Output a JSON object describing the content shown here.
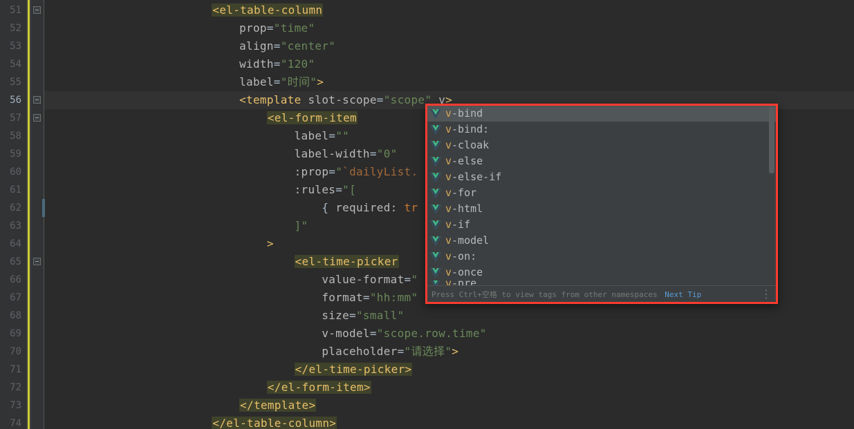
{
  "lines": {
    "start": 51,
    "end": 74,
    "active": 56,
    "fold_rows": [
      51,
      56,
      57,
      65
    ],
    "mod_rows": [
      62
    ]
  },
  "code": {
    "l51": {
      "indent": "",
      "open": "<",
      "tag": "el-table-column"
    },
    "l52": {
      "indent": "    ",
      "attr": "prop",
      "val": "time"
    },
    "l53": {
      "indent": "    ",
      "attr": "align",
      "val": "center"
    },
    "l54": {
      "indent": "    ",
      "attr": "width",
      "val": "120"
    },
    "l55": {
      "indent": "    ",
      "attr": "label",
      "val": "时间",
      "close": ">"
    },
    "l56": {
      "indent": "    ",
      "open": "<",
      "tag": "template",
      "a1": "slot-scope",
      "v1": "scope",
      "a2": "v",
      "close": ">"
    },
    "l57": {
      "indent": "        ",
      "open": "<",
      "tag": "el-form-item"
    },
    "l58": {
      "indent": "            ",
      "attr": "label",
      "val": ""
    },
    "l59": {
      "indent": "            ",
      "attr": "label-width",
      "val": "0"
    },
    "l60": {
      "indent": "            ",
      "attr": ":prop",
      "val": "`dailyList."
    },
    "l61": {
      "indent": "            ",
      "attr": ":rules",
      "val": "["
    },
    "l62": {
      "indent": "                ",
      "text": "{ required: tr"
    },
    "l63": {
      "indent": "            ",
      "text": "]\""
    },
    "l64": {
      "indent": "        ",
      "text": ">"
    },
    "l65": {
      "indent": "            ",
      "open": "<",
      "tag": "el-time-picker"
    },
    "l66": {
      "indent": "                ",
      "attr": "value-format",
      "val": ""
    },
    "l67": {
      "indent": "                ",
      "attr": "format",
      "val": "hh:mm"
    },
    "l68": {
      "indent": "                ",
      "attr": "size",
      "val": "small"
    },
    "l69": {
      "indent": "                ",
      "attr": "v-model",
      "val": "scope.row.time"
    },
    "l70": {
      "indent": "                ",
      "attr": "placeholder",
      "val": "请选择",
      "close": ">"
    },
    "l71": {
      "indent": "            ",
      "closeTag": "el-time-picker"
    },
    "l72": {
      "indent": "        ",
      "closeTag": "el-form-item"
    },
    "l73": {
      "indent": "    ",
      "closeTag": "template"
    },
    "l74": {
      "indent": "",
      "closeTag": "el-table-column"
    }
  },
  "popup": {
    "selected": 0,
    "items": [
      {
        "label": "v-bind"
      },
      {
        "label": "v-bind:"
      },
      {
        "label": "v-cloak"
      },
      {
        "label": "v-else"
      },
      {
        "label": "v-else-if"
      },
      {
        "label": "v-for"
      },
      {
        "label": "v-html"
      },
      {
        "label": "v-if"
      },
      {
        "label": "v-model"
      },
      {
        "label": "v-on:"
      },
      {
        "label": "v-once"
      },
      {
        "label": "v-pre"
      }
    ],
    "hint": "Press Ctrl+空格 to view tags from other namespaces",
    "nextTip": "Next Tip",
    "more": "⋮"
  }
}
